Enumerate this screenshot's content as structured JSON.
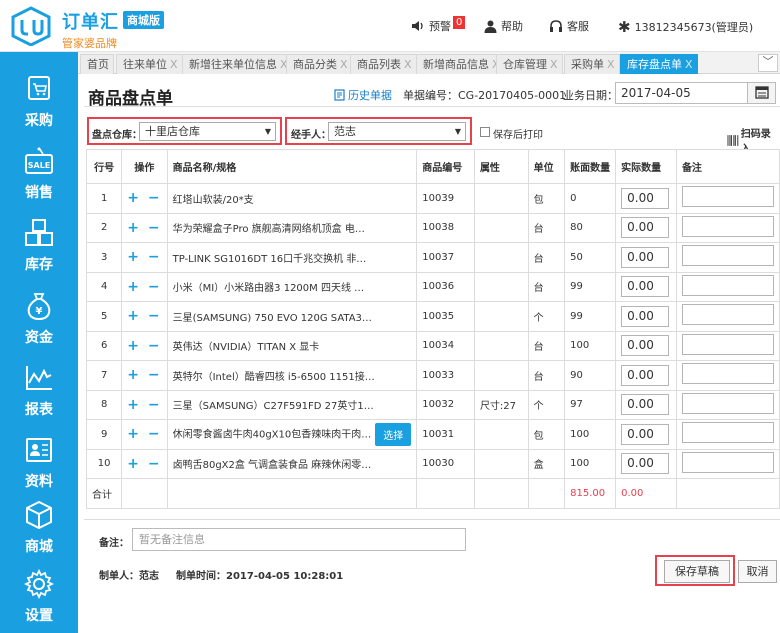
{
  "header": {
    "brand_name": "订单汇",
    "brand_badge": "商城版",
    "brand_sub": "管家婆品牌",
    "alert_label": "预警",
    "alert_count": "0",
    "help_label": "帮助",
    "service_label": "客服",
    "user_label": "13812345673(管理员)"
  },
  "sidebar": {
    "items": [
      {
        "label": "采购",
        "icon": "cart-icon"
      },
      {
        "label": "销售",
        "icon": "sale-tag-icon"
      },
      {
        "label": "库存",
        "icon": "boxes-icon"
      },
      {
        "label": "资金",
        "icon": "money-bag-icon"
      },
      {
        "label": "报表",
        "icon": "chart-line-icon"
      },
      {
        "label": "资料",
        "icon": "id-card-icon"
      },
      {
        "label": "商城",
        "icon": "cube-icon"
      },
      {
        "label": "设置",
        "icon": "gear-icon"
      }
    ]
  },
  "tabs": [
    {
      "label": "首页",
      "closable": false
    },
    {
      "label": "往来单位",
      "closable": true
    },
    {
      "label": "新增往来单位信息",
      "closable": true
    },
    {
      "label": "商品分类",
      "closable": true
    },
    {
      "label": "商品列表",
      "closable": true
    },
    {
      "label": "新增商品信息",
      "closable": true
    },
    {
      "label": "仓库管理",
      "closable": true
    },
    {
      "label": "采购单",
      "closable": true
    },
    {
      "label": "库存盘点单",
      "closable": true,
      "active": true
    }
  ],
  "close_glyph": "X",
  "tab_more": "﹀",
  "page": {
    "title": "商品盘点单",
    "history_link": "历史单据",
    "doc_no": "单据编号：CG-20170405-0001",
    "biz_date_label": "业务日期：",
    "biz_date": "2017-04-05"
  },
  "filters": {
    "warehouse_label": "盘点仓库：",
    "warehouse_value": "十里店仓库",
    "handler_label": "经手人：",
    "handler_value": "范志",
    "print_after_save": "保存后打印",
    "scan_label": "扫码录入",
    "dropdown_glyph": "▼"
  },
  "table": {
    "headers": [
      "行号",
      "操作",
      "商品名称/规格",
      "商品编号",
      "属性",
      "单位",
      "账面数量",
      "实际数量",
      "备注"
    ],
    "op_glyph": "+ −",
    "pick_label": "选择",
    "rows": [
      {
        "no": "1",
        "name": "红塔山软装/20*支",
        "code": "10039",
        "attr": "",
        "unit": "包",
        "book": "0",
        "actual": "0.00"
      },
      {
        "no": "2",
        "name": "华为荣耀盒子Pro 旗舰高清网络机顶盒 电…",
        "code": "10038",
        "attr": "",
        "unit": "台",
        "book": "80",
        "actual": "0.00"
      },
      {
        "no": "3",
        "name": "TP-LINK SG1016DT 16口千兆交换机 非…",
        "code": "10037",
        "attr": "",
        "unit": "台",
        "book": "50",
        "actual": "0.00"
      },
      {
        "no": "4",
        "name": "小米（MI）小米路由器3 1200M 四天线 …",
        "code": "10036",
        "attr": "",
        "unit": "台",
        "book": "99",
        "actual": "0.00"
      },
      {
        "no": "5",
        "name": "三星(SAMSUNG) 750 EVO 120G SATA3…",
        "code": "10035",
        "attr": "",
        "unit": "个",
        "book": "99",
        "actual": "0.00"
      },
      {
        "no": "6",
        "name": "英伟达（NVIDIA）TITAN X 显卡",
        "code": "10034",
        "attr": "",
        "unit": "台",
        "book": "100",
        "actual": "0.00"
      },
      {
        "no": "7",
        "name": "英特尔（Intel）酷睿四核 i5-6500 1151接…",
        "code": "10033",
        "attr": "",
        "unit": "台",
        "book": "90",
        "actual": "0.00"
      },
      {
        "no": "8",
        "name": "三星（SAMSUNG）C27F591FD 27英寸1…",
        "code": "10032",
        "attr": "尺寸:27",
        "unit": "个",
        "book": "97",
        "actual": "0.00"
      },
      {
        "no": "9",
        "name": "休闲零食酱卤牛肉40gX10包香辣味肉干肉…",
        "code": "10031",
        "attr": "",
        "unit": "包",
        "book": "100",
        "actual": "0.00",
        "pick": true
      },
      {
        "no": "10",
        "name": "卤鸭舌80gX2盒 气调盒装食品 麻辣休闲零…",
        "code": "10030",
        "attr": "",
        "unit": "盒",
        "book": "100",
        "actual": "0.00"
      }
    ],
    "total_label": "合计",
    "total_book": "815.00",
    "total_actual": "0.00"
  },
  "footer": {
    "note_label": "备注：",
    "note_placeholder": "暂无备注信息",
    "maker": "制单人：范志",
    "make_time": "制单时间：2017-04-05 10:28:01",
    "save_draft": "保存草稿",
    "cancel": "取消"
  },
  "colors": {
    "primary": "#1a9fe0",
    "highlight_border": "#e8414e",
    "total_red": "#e8414e"
  }
}
